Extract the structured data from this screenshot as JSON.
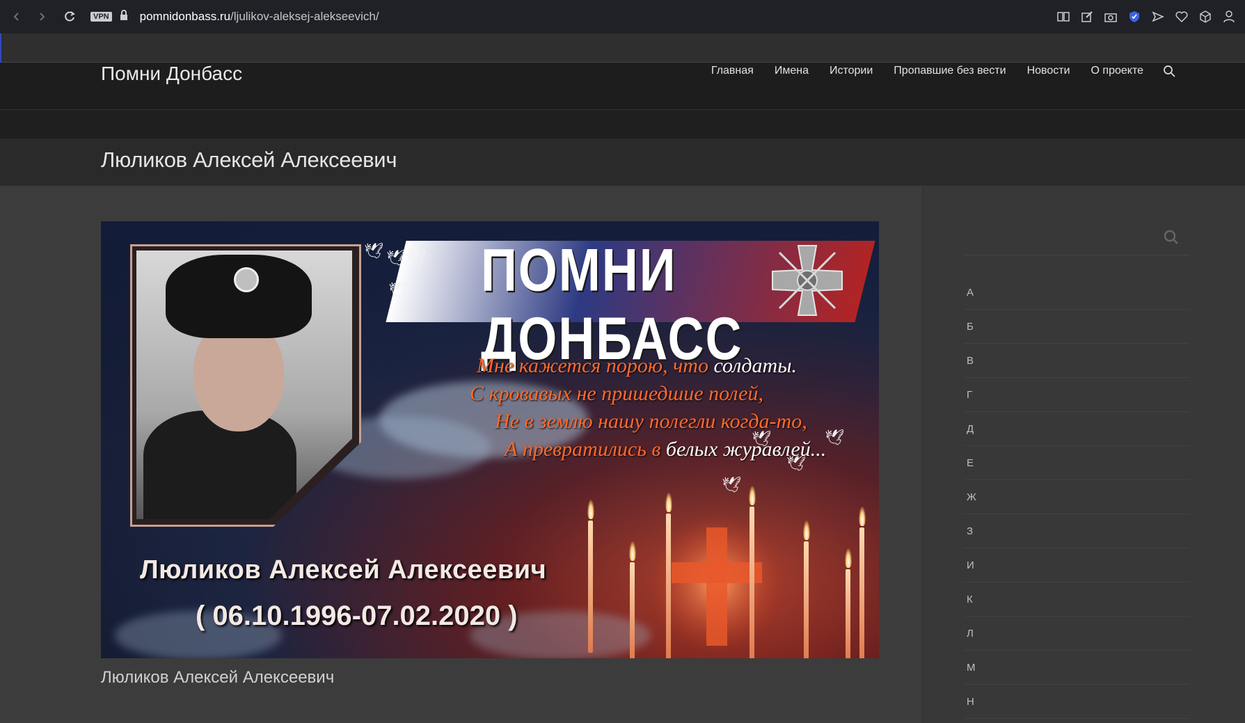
{
  "browser": {
    "vpn_label": "VPN",
    "url_domain": "pomnidonbass.ru",
    "url_path": "/ljulikov-aleksej-alekseevich/"
  },
  "site": {
    "title": "Помни Донбасс",
    "nav": [
      "Главная",
      "Имена",
      "Истории",
      "Пропавшие без вести",
      "Новости",
      "О проекте"
    ]
  },
  "page": {
    "title": "Люликов Алексей Алексеевич",
    "content_title": "Люликов Алексей Алексеевич"
  },
  "hero": {
    "banner": "ПОМНИ ДОНБАСС",
    "poem": [
      {
        "orange": "Мне кажется порою, что ",
        "white": "солдаты."
      },
      {
        "orange": "С кровавых не пришедшие полей,",
        "white": ""
      },
      {
        "orange": "Не в землю нашу полегли когда-то,",
        "white": ""
      },
      {
        "orange": "А превратились в ",
        "white": "белых журавлей..."
      }
    ],
    "name": "Люликов Алексей Алексеевич",
    "dates": "( 06.10.1996-07.02.2020 )"
  },
  "sidebar": {
    "search_placeholder": "",
    "alphabet": [
      "А",
      "Б",
      "В",
      "Г",
      "Д",
      "Е",
      "Ж",
      "З",
      "И",
      "К",
      "Л",
      "М",
      "Н"
    ]
  },
  "colors": {
    "accent_orange": "#ff6a2b",
    "browser_bar": "#1f2127",
    "page_bg": "#3c3c3c"
  }
}
